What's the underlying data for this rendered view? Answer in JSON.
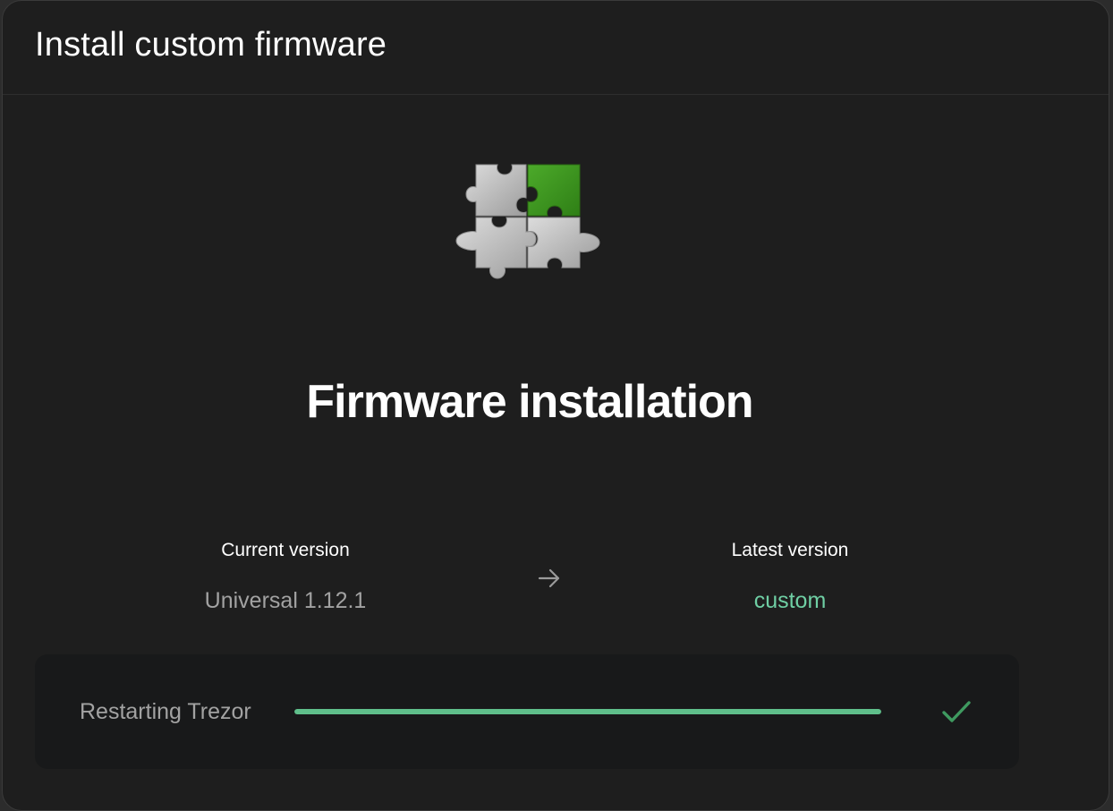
{
  "modal": {
    "title": "Install custom firmware"
  },
  "hero": {
    "icon": "puzzle-pieces-icon"
  },
  "main": {
    "heading": "Firmware installation"
  },
  "versions": {
    "current_label": "Current version",
    "current_value": "Universal 1.12.1",
    "arrow_icon": "arrow-right-icon",
    "latest_label": "Latest version",
    "latest_value": "custom"
  },
  "progress": {
    "label": "Restarting Trezor",
    "fraction": 1.0,
    "status_icon": "check-icon",
    "fill_color": "#5fbf8b"
  },
  "colors": {
    "accent_green": "#6fcfa4",
    "check_green": "#3f9a60",
    "background": "#1e1e1e"
  }
}
